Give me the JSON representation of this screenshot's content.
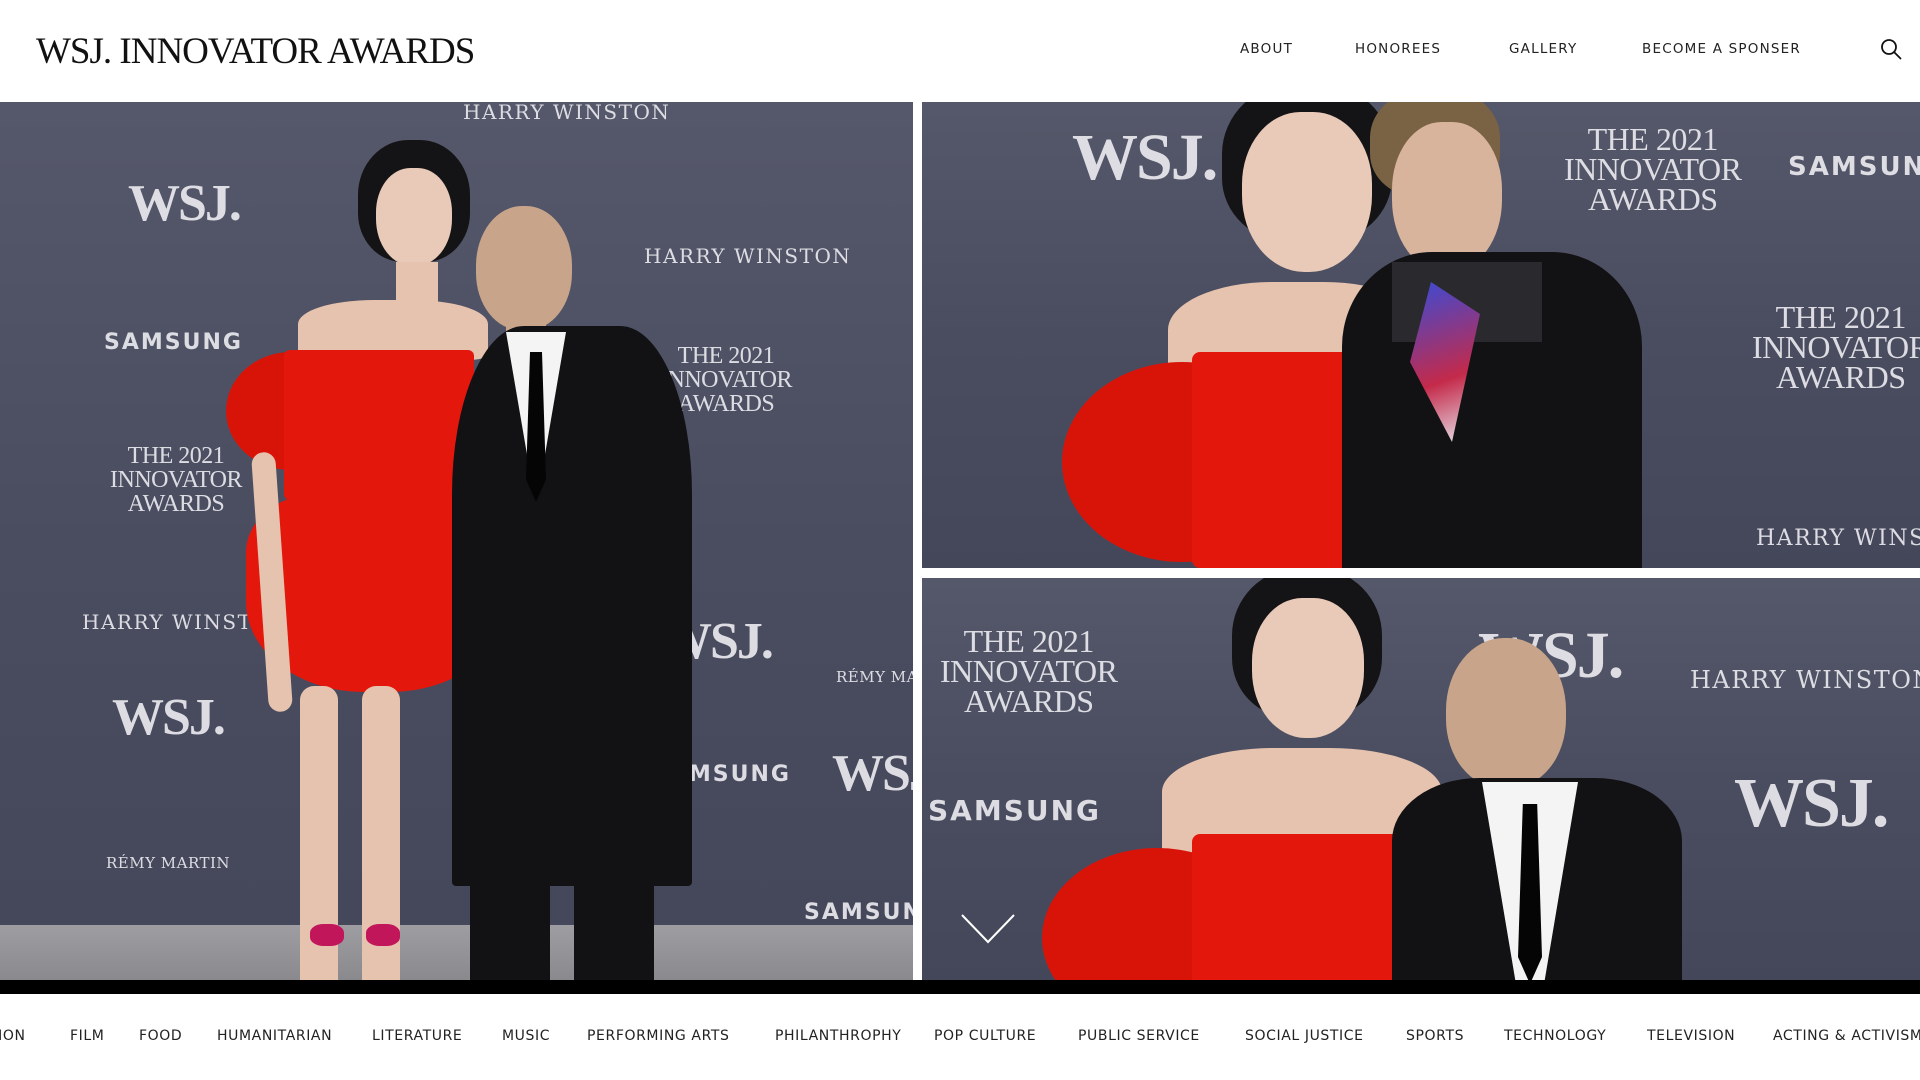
{
  "header": {
    "logo": "WSJ. INNOVATOR AWARDS",
    "nav": {
      "about": "ABOUT",
      "honorees": "HONOREES",
      "gallery": "GALLERY",
      "sponsor": "BECOME A SPONSER"
    },
    "search_icon": "search-icon"
  },
  "hero": {
    "backdrop": {
      "wsj": "WSJ.",
      "harry_winston": "HARRY WINSTON",
      "samsung": "SAMSUNG",
      "awards_line1": "THE 2021",
      "awards_line2": "INNOVATOR",
      "awards_line3": "AWARDS",
      "remy_martin": "RÉMY MARTIN"
    },
    "scroll_icon": "chevron-down-icon"
  },
  "categories": [
    "FASHION",
    "FILM",
    "FOOD",
    "HUMANITARIAN",
    "LITERATURE",
    "MUSIC",
    "PERFORMING ARTS",
    "PHILANTHROPHY",
    "POP CULTURE",
    "PUBLIC SERVICE",
    "SOCIAL JUSTICE",
    "SPORTS",
    "TECHNOLOGY",
    "TELEVISION",
    "ACTING & ACTIVISM"
  ],
  "colors": {
    "backdrop": "#4e5164",
    "dress": "#e3170c",
    "text": "#222222"
  }
}
